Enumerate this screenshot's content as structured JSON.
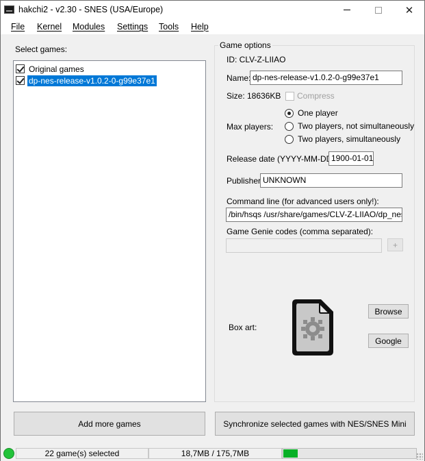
{
  "window": {
    "title": "hakchi2 - v2.30 - SNES (USA/Europe)"
  },
  "menu": [
    "File",
    "Kernel",
    "Modules",
    "Settings",
    "Tools",
    "Help"
  ],
  "select_games_label": "Select games:",
  "games": [
    {
      "label": "Original games",
      "checked": true,
      "selected": false
    },
    {
      "label": "dp-nes-release-v1.0.2-0-g99e37e1",
      "checked": true,
      "selected": true
    }
  ],
  "options": {
    "group_title": "Game options",
    "id_text": "ID: CLV-Z-LIIAO",
    "name_label": "Name:",
    "name_value": "dp-nes-release-v1.0.2-0-g99e37e1",
    "size_text": "Size: 18636KB",
    "compress_label": "Compress",
    "max_players_label": "Max players:",
    "players": [
      {
        "label": "One player",
        "checked": true
      },
      {
        "label": "Two players, not simultaneously",
        "checked": false
      },
      {
        "label": "Two players, simultaneously",
        "checked": false
      }
    ],
    "release_label": "Release date (YYYY-MM-DD):",
    "release_value": "1900-01-01",
    "publisher_label": "Publisher:",
    "publisher_value": "UNKNOWN",
    "cmdline_label": "Command line (for advanced users only!):",
    "cmdline_value": "/bin/hsqs /usr/share/games/CLV-Z-LIIAO/dp_nes_release",
    "genie_label": "Game Genie codes (comma separated):",
    "genie_value": "",
    "genie_add": "+",
    "boxart_label": "Box art:",
    "browse_label": "Browse",
    "google_label": "Google"
  },
  "buttons": {
    "add_games": "Add more games",
    "sync": "Synchronize selected games with NES/SNES Mini"
  },
  "status": {
    "selected_text": "22 game(s) selected",
    "size_text": "18,7MB / 175,7MB",
    "progress_fraction": 0.107,
    "status_color": "#22c33a",
    "progress_color": "#06b025"
  }
}
